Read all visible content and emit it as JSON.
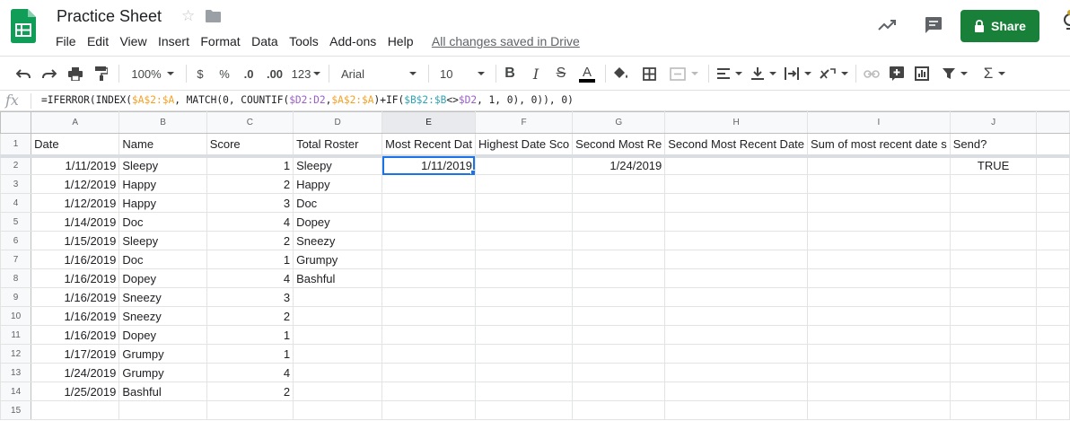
{
  "app": {
    "title": "Practice Sheet",
    "saved_status": "All changes saved in Drive",
    "share_label": "Share",
    "accent_color": "#188038",
    "menu": [
      "File",
      "Edit",
      "View",
      "Insert",
      "Format",
      "Data",
      "Tools",
      "Add-ons",
      "Help"
    ]
  },
  "toolbar": {
    "zoom": "100%",
    "currency": "$",
    "percent": "%",
    "decrease_decimals": ".0",
    "increase_decimals": ".00",
    "more_formats": "123",
    "font": "Arial",
    "font_size": "10",
    "icons": [
      "undo-icon",
      "redo-icon",
      "print-icon",
      "paint-format-icon",
      "bold-icon",
      "italic-icon",
      "strikethrough-icon",
      "text-color-icon",
      "fill-color-icon",
      "borders-icon",
      "merge-icon",
      "align-icon",
      "valign-icon",
      "wrap-icon",
      "rotate-icon",
      "link-icon",
      "comment-icon",
      "chart-icon",
      "filter-icon",
      "functions-icon"
    ]
  },
  "formula_bar": {
    "fx": "fx",
    "parts": [
      {
        "t": "=IFERROR(INDEX(",
        "c": ""
      },
      {
        "t": "$A$2:$A",
        "c": "orange"
      },
      {
        "t": ", MATCH(0, COUNTIF(",
        "c": ""
      },
      {
        "t": "$D2:D2",
        "c": "purple"
      },
      {
        "t": ",",
        "c": ""
      },
      {
        "t": "$A$2:$A",
        "c": "orange"
      },
      {
        "t": ")+IF(",
        "c": ""
      },
      {
        "t": "$B$2:$B",
        "c": "teal"
      },
      {
        "t": "<>",
        "c": ""
      },
      {
        "t": "$D2",
        "c": "purple"
      },
      {
        "t": ", 1, 0), 0)), 0)",
        "c": ""
      }
    ]
  },
  "sheet": {
    "columns": [
      "A",
      "B",
      "C",
      "D",
      "E",
      "F",
      "G",
      "H",
      "I",
      "J"
    ],
    "selected_column": "E",
    "active_cell": "E2",
    "header_row": [
      "Date",
      "Name",
      "Score",
      "Total Roster",
      "Most Recent Dat",
      "Highest Date Sco",
      "Second Most Re",
      "Second Most Recent Date",
      "Sum of most recent date s",
      "Send?"
    ],
    "rows": [
      [
        "1/11/2019",
        "Sleepy",
        "1",
        "Sleepy",
        "1/11/2019",
        "",
        "1/24/2019",
        "",
        "",
        "TRUE"
      ],
      [
        "1/12/2019",
        "Happy",
        "2",
        "Happy",
        "",
        "",
        "",
        "",
        "",
        ""
      ],
      [
        "1/12/2019",
        "Happy",
        "3",
        "Doc",
        "",
        "",
        "",
        "",
        "",
        ""
      ],
      [
        "1/14/2019",
        "Doc",
        "4",
        "Dopey",
        "",
        "",
        "",
        "",
        "",
        ""
      ],
      [
        "1/15/2019",
        "Sleepy",
        "2",
        "Sneezy",
        "",
        "",
        "",
        "",
        "",
        ""
      ],
      [
        "1/16/2019",
        "Doc",
        "1",
        "Grumpy",
        "",
        "",
        "",
        "",
        "",
        ""
      ],
      [
        "1/16/2019",
        "Dopey",
        "4",
        "Bashful",
        "",
        "",
        "",
        "",
        "",
        ""
      ],
      [
        "1/16/2019",
        "Sneezy",
        "3",
        "",
        "",
        "",
        "",
        "",
        "",
        ""
      ],
      [
        "1/16/2019",
        "Sneezy",
        "2",
        "",
        "",
        "",
        "",
        "",
        "",
        ""
      ],
      [
        "1/16/2019",
        "Dopey",
        "1",
        "",
        "",
        "",
        "",
        "",
        "",
        ""
      ],
      [
        "1/17/2019",
        "Grumpy",
        "1",
        "",
        "",
        "",
        "",
        "",
        "",
        ""
      ],
      [
        "1/24/2019",
        "Grumpy",
        "4",
        "",
        "",
        "",
        "",
        "",
        "",
        ""
      ],
      [
        "1/25/2019",
        "Bashful",
        "2",
        "",
        "",
        "",
        "",
        "",
        "",
        ""
      ],
      [
        "",
        "",
        "",
        "",
        "",
        "",
        "",
        "",
        "",
        ""
      ]
    ]
  }
}
